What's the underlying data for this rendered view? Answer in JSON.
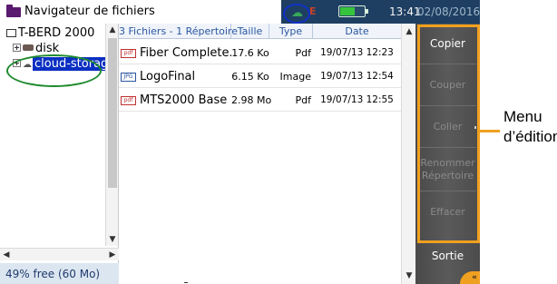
{
  "titlebar": {
    "app_title": "Navigateur de fichiers",
    "clock": "13:41",
    "date": "02/08/2016",
    "status_icons": [
      "cloud-icon",
      "mcc-icon",
      "battery-icon"
    ]
  },
  "tree": {
    "root": "T-BERD 2000",
    "nodes": [
      {
        "label": "disk",
        "icon": "disk-icon"
      },
      {
        "label": "cloud-storage",
        "icon": "cloud-icon",
        "selected": true
      }
    ],
    "free_space": "49% free (60 Mo)"
  },
  "filelist": {
    "headers": {
      "name": "3 Fichiers - 1 Répertoire",
      "size": "Taille",
      "type": "Type",
      "date": "Date"
    },
    "rows": [
      {
        "icon": "pdf",
        "name": "Fiber Complete...",
        "size": "17.6 Ko",
        "type": "Pdf",
        "date": "19/07/13 12:23"
      },
      {
        "icon": "JPG",
        "name": "LogoFinal",
        "size": "6.15 Ko",
        "type": "Image",
        "date": "19/07/13 12:54"
      },
      {
        "icon": "pdf",
        "name": "MTS2000 Base ...",
        "size": "2.98 Mo",
        "type": "Pdf",
        "date": "19/07/13 12:55"
      }
    ]
  },
  "editmenu": {
    "copy": "Copier",
    "cut": "Couper",
    "paste": "Coller",
    "rename_line1": "Renommer",
    "rename_line2": "Répertoire",
    "delete": "Effacer",
    "exit": "Sortie",
    "corner_glyph": "«"
  },
  "annotation": {
    "line1": "Menu",
    "line2": "d’édition",
    "colors": {
      "highlight": "#f0a020",
      "tree_circle": "#1f8a2e",
      "status_circle": "#1030c8"
    }
  }
}
